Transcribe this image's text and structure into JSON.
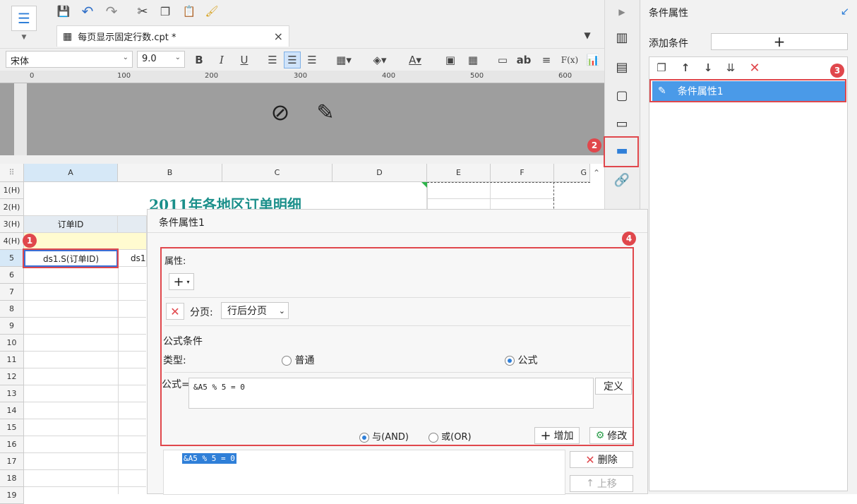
{
  "toolbar": {
    "file_tab_label": "每页显示固定行数.cpt *",
    "close_tab": "×",
    "font_family": "宋体",
    "font_size": "9.0",
    "bold": "B",
    "italic": "I",
    "underline": "U",
    "ab_label": "ab",
    "fx_label": "F(x)"
  },
  "ruler": {
    "marks": [
      "0",
      "100",
      "200",
      "300",
      "400",
      "500",
      "600"
    ]
  },
  "sheet": {
    "columns": [
      "A",
      "B",
      "C",
      "D",
      "E",
      "F",
      "G"
    ],
    "rows": [
      "1(H)",
      "2(H)",
      "3(H)",
      "4(H)",
      "5",
      "6",
      "7",
      "8",
      "9",
      "10",
      "11",
      "12",
      "13",
      "14",
      "15",
      "16",
      "17",
      "18",
      "19"
    ],
    "title_text": "2011年各地区订单明细",
    "header_a3": "订单ID",
    "cell_a5": "ds1.S(订单ID)",
    "cell_b5": "ds1"
  },
  "right_panel": {
    "title": "条件属性",
    "add_condition_label": "添加条件",
    "add_symbol": "+",
    "condition_item": "条件属性1"
  },
  "dialog": {
    "title": "条件属性1",
    "properties_label": "属性:",
    "add_symbol": "+",
    "paging_label": "分页:",
    "paging_value": "行后分页",
    "formula_section": "公式条件",
    "type_label": "类型:",
    "type_normal": "普通",
    "type_formula": "公式",
    "formula_label": "公式=",
    "formula_value": "&A5 % 5 = 0",
    "define_button": "定义",
    "and_label": "与(AND)",
    "or_label": "或(OR)",
    "add_button": "增加",
    "modify_button": "修改",
    "list_item": "&A5 % 5 = 0",
    "delete_button": "删除",
    "move_up_button": "上移"
  },
  "badges": [
    "1",
    "2",
    "3",
    "4"
  ],
  "colors": {
    "accent": "#2f7fd8",
    "highlight": "#e0474c",
    "title_teal": "#1b8f8a",
    "selected_row": "#4a9ae8"
  }
}
